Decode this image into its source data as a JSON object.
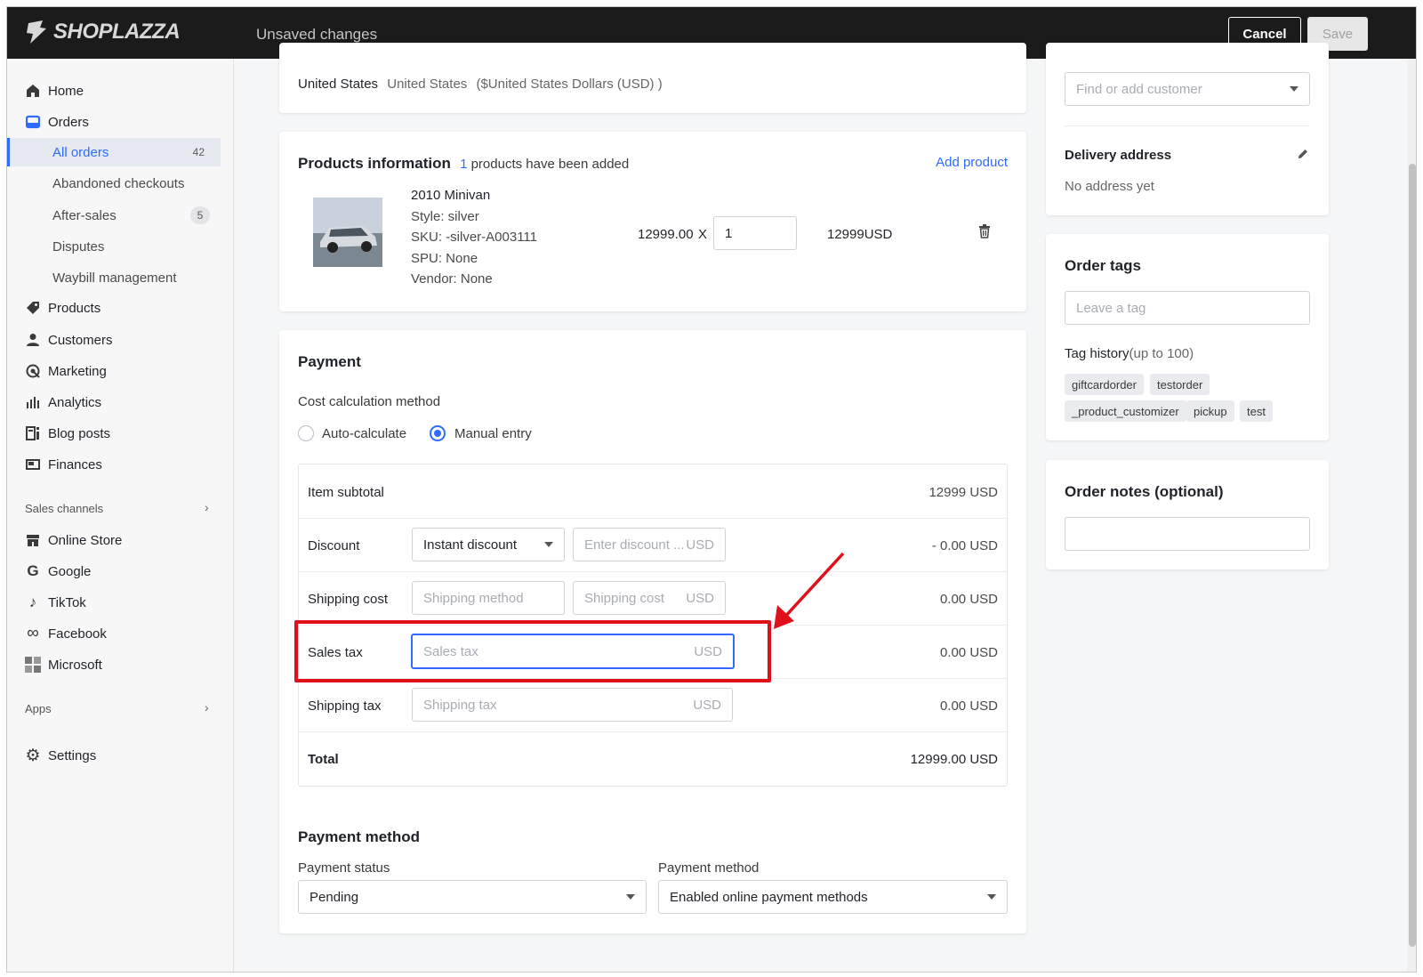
{
  "topbar": {
    "brand": "SHOPLAZZA",
    "status": "Unsaved changes",
    "cancel_label": "Cancel",
    "save_label": "Save"
  },
  "sidebar": {
    "items": [
      {
        "label": "Home",
        "icon": "home-icon"
      },
      {
        "label": "Orders",
        "icon": "orders-icon"
      },
      {
        "label": "Products",
        "icon": "tag-icon"
      },
      {
        "label": "Customers",
        "icon": "person-icon"
      },
      {
        "label": "Marketing",
        "icon": "marketing-icon"
      },
      {
        "label": "Analytics",
        "icon": "bar-chart-icon"
      },
      {
        "label": "Blog posts",
        "icon": "blog-icon"
      },
      {
        "label": "Finances",
        "icon": "finances-icon"
      }
    ],
    "order_sub": [
      {
        "label": "All orders",
        "badge": "42"
      },
      {
        "label": "Abandoned checkouts"
      },
      {
        "label": "After-sales",
        "badge": "5"
      },
      {
        "label": "Disputes"
      },
      {
        "label": "Waybill management"
      }
    ],
    "sales_channels_label": "Sales channels",
    "channels": [
      {
        "label": "Online Store",
        "icon": "store-icon"
      },
      {
        "label": "Google",
        "icon": "google-icon"
      },
      {
        "label": "TikTok",
        "icon": "tiktok-icon"
      },
      {
        "label": "Facebook",
        "icon": "meta-icon"
      },
      {
        "label": "Microsoft",
        "icon": "microsoft-icon"
      }
    ],
    "apps_label": "Apps",
    "settings_label": "Settings"
  },
  "market": {
    "country_bold": "United States",
    "country": "United States",
    "currency": "($United States Dollars (USD) )"
  },
  "products": {
    "title": "Products information",
    "count": "1",
    "count_text": "products have been added",
    "add_label": "Add product",
    "item": {
      "name": "2010 Minivan",
      "style": "Style: silver",
      "sku": "SKU: -silver-A003111",
      "spu": "SPU: None",
      "vendor": "Vendor: None",
      "price": "12999.00",
      "times": "X",
      "qty": "1",
      "total": "12999USD"
    }
  },
  "payment": {
    "title": "Payment",
    "method_label": "Cost calculation method",
    "auto_label": "Auto-calculate",
    "manual_label": "Manual entry",
    "rows": {
      "subtotal_label": "Item subtotal",
      "subtotal_amount": "12999 USD",
      "discount_label": "Discount",
      "discount_select": "Instant discount",
      "discount_placeholder": "Enter discount ...",
      "discount_amount": "- 0.00 USD",
      "shipping_label": "Shipping cost",
      "shipping_method_placeholder": "Shipping method",
      "shipping_cost_placeholder": "Shipping cost",
      "shipping_amount": "0.00 USD",
      "sales_tax_label": "Sales tax",
      "sales_tax_placeholder": "Sales tax",
      "sales_tax_amount": "0.00 USD",
      "shipping_tax_label": "Shipping tax",
      "shipping_tax_placeholder": "Shipping tax",
      "shipping_tax_amount": "0.00 USD",
      "total_label": "Total",
      "total_amount": "12999.00 USD",
      "currency": "USD"
    },
    "pm_title": "Payment method",
    "status_label": "Payment status",
    "status_value": "Pending",
    "pm_label": "Payment method",
    "pm_value": "Enabled online payment methods"
  },
  "customer": {
    "placeholder": "Find or add customer",
    "delivery_title": "Delivery address",
    "delivery_value": "No address yet"
  },
  "tags": {
    "title": "Order tags",
    "placeholder": "Leave a tag",
    "history_label": "Tag history",
    "history_suffix": "(up to 100)",
    "list": [
      "giftcardorder",
      "testorder",
      "_product_customizer",
      "pickup",
      "test"
    ]
  },
  "notes": {
    "title": "Order notes (optional)"
  },
  "colors": {
    "accent": "#2f6bff",
    "highlight": "#e0101a"
  }
}
